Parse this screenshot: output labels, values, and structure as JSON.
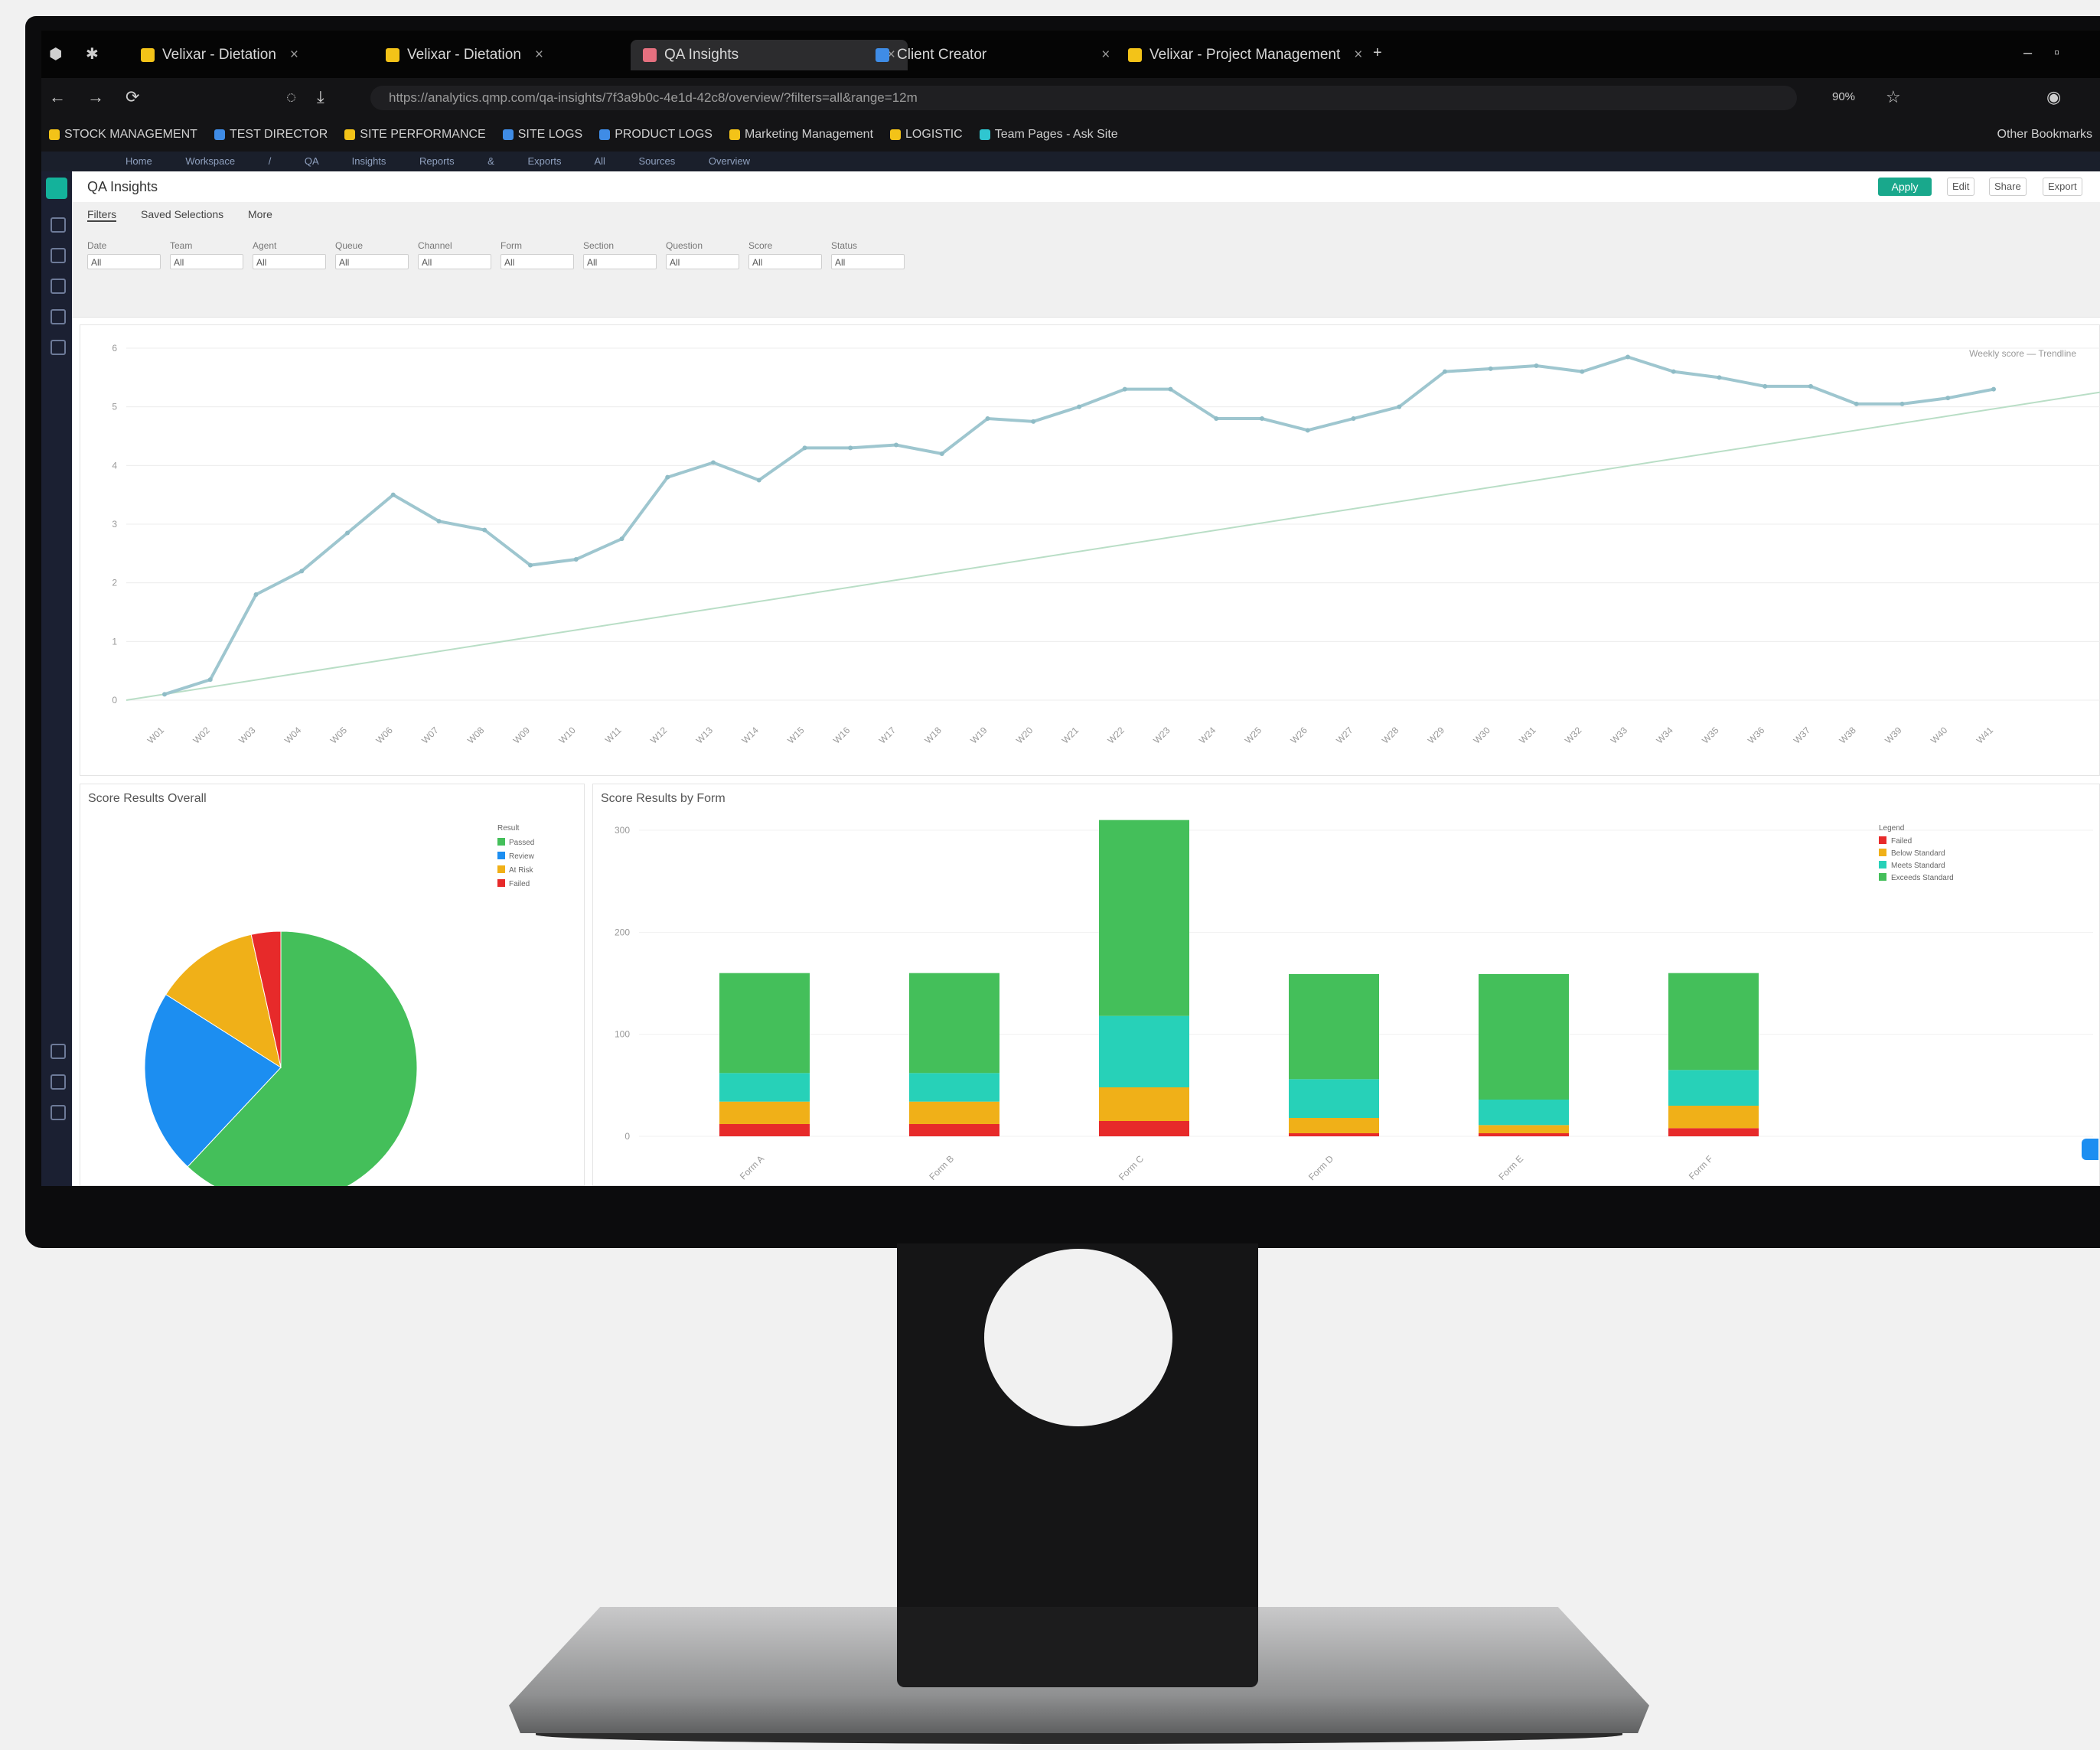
{
  "browser": {
    "tabs": [
      {
        "label": "Velixar - Dietation",
        "icon": "yellow-doc-icon",
        "active": false
      },
      {
        "label": "Velixar - Dietation",
        "icon": "yellow-doc-icon",
        "active": false
      },
      {
        "label": "QA Insights",
        "icon": "pink-app-icon",
        "active": true
      },
      {
        "label": "Client Creator",
        "icon": "blue-app-icon",
        "active": false
      },
      {
        "label": "Velixar - Project Management",
        "icon": "yellow-doc-icon",
        "active": false
      }
    ],
    "new_tab": "+",
    "url": "https://analytics.qmp.com/qa-insights/7f3a9b0c-4e1d-42c8/overview/?filters=all&range=12m",
    "zoom": "90%",
    "bookmarks": [
      {
        "label": "STOCK MANAGEMENT",
        "icon": "yellow-folder-icon"
      },
      {
        "label": "TEST DIRECTOR",
        "icon": "blue-globe-icon"
      },
      {
        "label": "SITE PERFORMANCE",
        "icon": "yellow-folder-icon"
      },
      {
        "label": "SITE LOGS",
        "icon": "blue-globe-icon"
      },
      {
        "label": "PRODUCT LOGS",
        "icon": "blue-globe-icon"
      },
      {
        "label": "Marketing Management",
        "icon": "yellow-folder-icon"
      },
      {
        "label": "LOGISTIC",
        "icon": "yellow-folder-icon"
      },
      {
        "label": "Team Pages - Ask Site",
        "icon": "cyan-page-icon"
      }
    ],
    "other_bookmarks": "Other Bookmarks",
    "app_strip": [
      "Home",
      "Workspace / QA Insights",
      "Reports & Exports",
      "All Sources",
      "Overview"
    ]
  },
  "app": {
    "title": "QA Insights",
    "header_buttons": {
      "primary": "Apply",
      "b1": "Edit",
      "b2": "Share",
      "b3": "Export"
    },
    "filter_tabs": [
      "Filters",
      "Saved Selections",
      "More"
    ],
    "filters": [
      {
        "label": "Date",
        "value": "All"
      },
      {
        "label": "Team",
        "value": "All"
      },
      {
        "label": "Agent",
        "value": "All"
      },
      {
        "label": "Queue",
        "value": "All"
      },
      {
        "label": "Channel",
        "value": "All"
      },
      {
        "label": "Form",
        "value": "All"
      },
      {
        "label": "Section",
        "value": "All"
      },
      {
        "label": "Question",
        "value": "All"
      },
      {
        "label": "Score",
        "value": "All"
      },
      {
        "label": "Status",
        "value": "All"
      }
    ]
  },
  "line_panel": {
    "legend_note": "Weekly score  — Trendline"
  },
  "pie_panel": {
    "title": "Score Results Overall"
  },
  "bar_panel": {
    "title": "Score Results by Form"
  },
  "colors": {
    "green": "#44bf5a",
    "teal": "#27d1b8",
    "orange": "#f0b018",
    "red": "#e72a2a",
    "blue": "#1c8ef1",
    "accent": "#19a88c"
  },
  "chart_data": [
    {
      "type": "line",
      "title": "",
      "xlabel": "",
      "ylabel": "",
      "x": [
        "W01",
        "W02",
        "W03",
        "W04",
        "W05",
        "W06",
        "W07",
        "W08",
        "W09",
        "W10",
        "W11",
        "W12",
        "W13",
        "W14",
        "W15",
        "W16",
        "W17",
        "W18",
        "W19",
        "W20",
        "W21",
        "W22",
        "W23",
        "W24",
        "W25",
        "W26",
        "W27",
        "W28",
        "W29",
        "W30",
        "W31",
        "W32",
        "W33",
        "W34",
        "W35",
        "W36",
        "W37",
        "W38",
        "W39",
        "W40",
        "W41"
      ],
      "series": [
        {
          "values": [
            0.1,
            0.35,
            1.8,
            2.2,
            2.85,
            3.5,
            3.05,
            2.9,
            2.3,
            2.4,
            2.75,
            3.8,
            4.05,
            3.75,
            4.3,
            4.3,
            4.35,
            4.2,
            4.8,
            4.75,
            5.0,
            5.3,
            5.3,
            4.8,
            4.8,
            4.6,
            4.8,
            5.0,
            5.6,
            5.65,
            5.7,
            5.6,
            5.85,
            5.6,
            5.5,
            5.35,
            5.35,
            5.05,
            5.05,
            5.15,
            5.3
          ]
        },
        {
          "values": [
            0.0,
            5.25
          ]
        }
      ],
      "ylim": [
        0,
        6
      ],
      "grid": true
    },
    {
      "type": "pie",
      "title": "Score Results Overall",
      "labels": [
        "Passed",
        "Review",
        "At Risk",
        "Failed"
      ],
      "values": [
        62,
        22,
        12.5,
        3.5
      ],
      "legend_title": "Result",
      "legend": "top-right"
    },
    {
      "type": "bar",
      "title": "Score Results by Form",
      "stacked": true,
      "categories": [
        "Form A",
        "Form B",
        "Form C",
        "Form D",
        "Form E",
        "Form F"
      ],
      "series": [
        {
          "name": "Failed",
          "values": [
            12,
            12,
            15,
            3,
            3,
            8
          ]
        },
        {
          "name": "Below Standard",
          "values": [
            22,
            22,
            33,
            15,
            8,
            22
          ]
        },
        {
          "name": "Meets Standard",
          "values": [
            28,
            28,
            70,
            38,
            25,
            35
          ]
        },
        {
          "name": "Exceeds Standard",
          "values": [
            98,
            98,
            192,
            103,
            123,
            95
          ]
        }
      ],
      "ylim": [
        0,
        300
      ],
      "legend_title": "Legend",
      "legend": "top-right"
    }
  ]
}
